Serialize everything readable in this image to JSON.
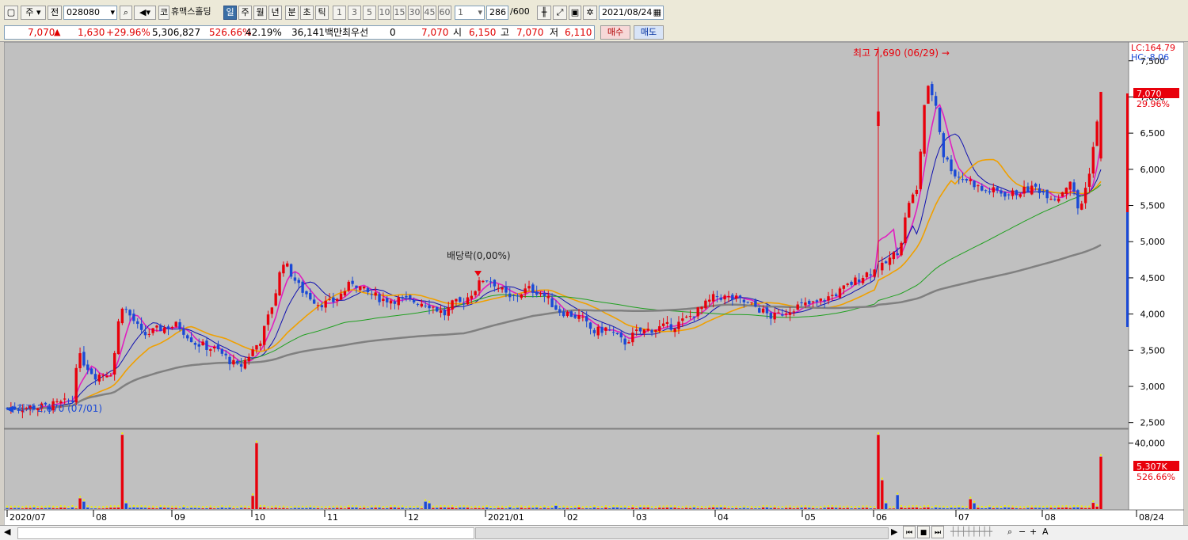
{
  "toolbar": {
    "market_type": "주",
    "view_toggle": "전",
    "code": "028080",
    "exchange": "코",
    "name": "휴맥스홀딩",
    "periods": [
      "일",
      "주",
      "월",
      "년"
    ],
    "minute_units": [
      "분",
      "초",
      "틱"
    ],
    "intervals": [
      "1",
      "3",
      "5",
      "10",
      "15",
      "30",
      "45",
      "60"
    ],
    "interval_value": "1",
    "count": "286",
    "count_max": "/600",
    "date": "2021/08/24"
  },
  "info": {
    "price": "7,070",
    "change": "1,630",
    "change_pct": "+29.96%",
    "volume": "5,306,827",
    "vol_ratio": "526.66%",
    "turnover": "42.19%",
    "amount": "36,141백만",
    "prio_label": "최우선",
    "prio_qty": "0",
    "prio_price": "7,070",
    "open_label": "시",
    "open": "6,150",
    "high_label": "고",
    "high": "7,070",
    "low_label": "저",
    "low": "6,110",
    "buy": "매수",
    "sell": "매도"
  },
  "colors": {
    "up": "#e8000b",
    "down": "#1a49d6",
    "ma5": "#e020c0",
    "ma10": "#1010b0",
    "ma20": "#f0a000",
    "ma60": "#20a020",
    "ma120": "#808080",
    "bg": "#c0c0c0"
  },
  "chart_data": {
    "type": "candlestick",
    "price_axis": {
      "ticks": [
        "2,500",
        "3,000",
        "3,500",
        "4,000",
        "4,500",
        "5,000",
        "5,500",
        "6,000",
        "6,500",
        "7,000",
        "7,500"
      ],
      "ylim": [
        2420,
        7760
      ]
    },
    "volume_axis": {
      "ticks": [
        "40,000"
      ],
      "ylim": [
        0,
        48000
      ]
    },
    "date_labels": [
      "2020/07",
      "08",
      "09",
      "10",
      "11",
      "12",
      "2021/01",
      "02",
      "03",
      "04",
      "05",
      "06",
      "07",
      "08",
      "08/24"
    ],
    "annotations": {
      "high": "최고 7,690 (06/29)",
      "low": "최저 2,670 (07/01)",
      "dividend": "배당락(0,00%)",
      "lc": "LC:164.79",
      "hc": "HC:-8.06",
      "last_price": "7,070",
      "last_change": "29.96%",
      "last_volume": "5,307K",
      "last_vol_pct": "526.66%"
    },
    "series": [
      {
        "name": "MA5"
      },
      {
        "name": "MA10"
      },
      {
        "name": "MA20"
      },
      {
        "name": "MA60"
      },
      {
        "name": "MA120"
      }
    ]
  }
}
